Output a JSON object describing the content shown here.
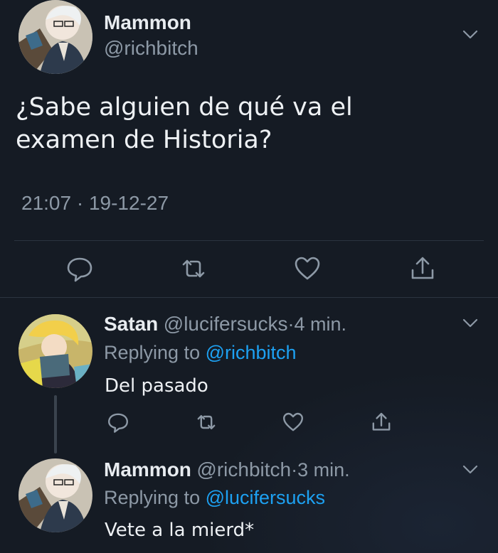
{
  "tweet": {
    "author_name": "Mammon",
    "author_handle": "@richbitch",
    "text_line1": "¿Sabe alguien de qué va el",
    "text_line2": "examen de Historia?",
    "timestamp": "21:07 · 19-12-27",
    "avatar_icon": "anime-avatar-white-hair",
    "menu_icon": "chevron-down-icon"
  },
  "actions": {
    "reply_icon": "reply-icon",
    "retweet_icon": "retweet-icon",
    "like_icon": "heart-icon",
    "share_icon": "share-icon"
  },
  "replies": [
    {
      "author_name": "Satan",
      "author_handle": "@lucifersucks",
      "separator": "·",
      "time": "4 min.",
      "replying_prefix": "Replying to",
      "replying_to": "@richbitch",
      "text": "Del pasado",
      "avatar_icon": "anime-avatar-blond-hair"
    },
    {
      "author_name": "Mammon",
      "author_handle": "@richbitch",
      "separator": "·",
      "time": "3 min.",
      "replying_prefix": "Replying to",
      "replying_to": "@lucifersucks",
      "text": "Vete a la mierd*",
      "avatar_icon": "anime-avatar-white-hair"
    }
  ],
  "colors": {
    "background": "#151b24",
    "text": "#eef1f4",
    "muted": "#8d99a6",
    "link": "#1da1f2",
    "divider": "#2b3440"
  }
}
